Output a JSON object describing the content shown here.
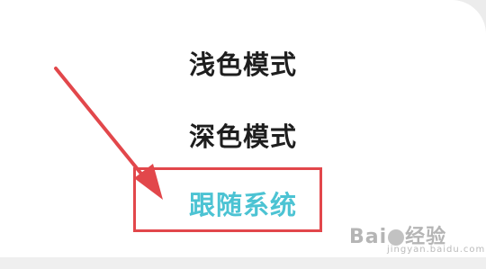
{
  "theme_menu": {
    "options": [
      {
        "label": "浅色模式"
      },
      {
        "label": "深色模式"
      },
      {
        "label": "跟随系统"
      }
    ],
    "selected_color": "#4cc3d3",
    "annotation_color": "#e2474b"
  },
  "watermark": {
    "brand_left": "Bai",
    "brand_right": "经验",
    "sub": "jingyan.baidu.com"
  }
}
